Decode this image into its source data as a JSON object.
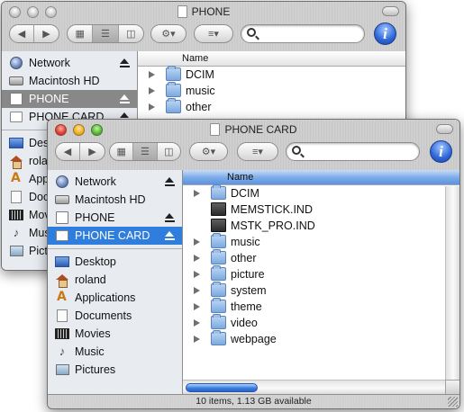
{
  "back_window": {
    "title": "PHONE",
    "sidebar": {
      "devices": [
        {
          "label": "Network",
          "icon": "globe-icon",
          "eject": true
        },
        {
          "label": "Macintosh HD",
          "icon": "hard-disk-icon",
          "eject": false
        },
        {
          "label": "PHONE",
          "icon": "phone-volume-icon",
          "eject": true,
          "selected": true
        },
        {
          "label": "PHONE CARD",
          "icon": "card-volume-icon",
          "eject": true
        }
      ],
      "places": [
        {
          "label": "Desk",
          "icon": "desktop-icon"
        },
        {
          "label": "rola",
          "icon": "home-icon"
        },
        {
          "label": "App",
          "icon": "applications-icon"
        },
        {
          "label": "Doc",
          "icon": "documents-icon"
        },
        {
          "label": "Movi",
          "icon": "movies-icon"
        },
        {
          "label": "Mus",
          "icon": "music-icon"
        },
        {
          "label": "Pictu",
          "icon": "pictures-icon"
        }
      ]
    },
    "column_header": "Name",
    "files": [
      {
        "name": "DCIM",
        "type": "folder"
      },
      {
        "name": "music",
        "type": "folder"
      },
      {
        "name": "other",
        "type": "folder"
      }
    ]
  },
  "front_window": {
    "title": "PHONE CARD",
    "search_placeholder": "",
    "info_label": "i",
    "sidebar": {
      "devices": [
        {
          "label": "Network",
          "icon": "globe-icon",
          "eject": true
        },
        {
          "label": "Macintosh HD",
          "icon": "hard-disk-icon",
          "eject": false
        },
        {
          "label": "PHONE",
          "icon": "phone-volume-icon",
          "eject": true
        },
        {
          "label": "PHONE CARD",
          "icon": "card-volume-icon",
          "eject": true,
          "selected": true
        }
      ],
      "places": [
        {
          "label": "Desktop",
          "icon": "desktop-icon"
        },
        {
          "label": "roland",
          "icon": "home-icon"
        },
        {
          "label": "Applications",
          "icon": "applications-icon"
        },
        {
          "label": "Documents",
          "icon": "documents-icon"
        },
        {
          "label": "Movies",
          "icon": "movies-icon"
        },
        {
          "label": "Music",
          "icon": "music-icon"
        },
        {
          "label": "Pictures",
          "icon": "pictures-icon"
        }
      ]
    },
    "column_header": "Name",
    "files": [
      {
        "name": "DCIM",
        "type": "folder",
        "expandable": true
      },
      {
        "name": "MEMSTICK.IND",
        "type": "file",
        "expandable": false
      },
      {
        "name": "MSTK_PRO.IND",
        "type": "file",
        "expandable": false
      },
      {
        "name": "music",
        "type": "folder",
        "expandable": true
      },
      {
        "name": "other",
        "type": "folder",
        "expandable": true
      },
      {
        "name": "picture",
        "type": "folder",
        "expandable": true
      },
      {
        "name": "system",
        "type": "folder",
        "expandable": true
      },
      {
        "name": "theme",
        "type": "folder",
        "expandable": true
      },
      {
        "name": "video",
        "type": "folder",
        "expandable": true
      },
      {
        "name": "webpage",
        "type": "folder",
        "expandable": true
      }
    ],
    "status": "10 items, 1.13 GB available"
  },
  "colors": {
    "selection_blue": "#2f7ddc",
    "selection_grey": "#888888",
    "column_header_active": "#79a9e8",
    "sidebar_bg": "#e8ecf1"
  }
}
